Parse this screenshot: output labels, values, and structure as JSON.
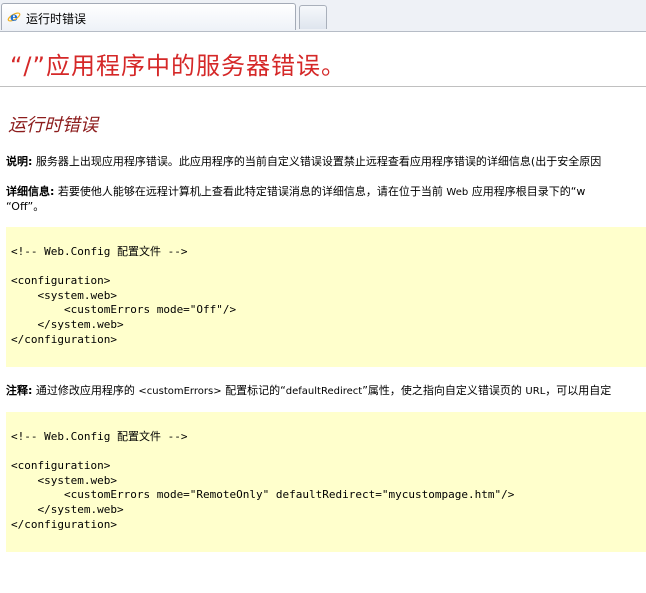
{
  "browser": {
    "tab_title": "运行时错误",
    "icons": {
      "tab_icon": "ie-logo-icon",
      "new_tab": "new-tab-button"
    }
  },
  "page": {
    "heading": "“/”应用程序中的服务器错误。",
    "subheading": "运行时错误",
    "description": {
      "label": "说明:",
      "text": " 服务器上出现应用程序错误。此应用程序的当前自定义错误设置禁止远程查看应用程序错误的详细信息(出于安全原因"
    },
    "details": {
      "label": "详细信息:",
      "text": " 若要使他人能够在远程计算机上查看此特定错误消息的详细信息，请在位于当前 ",
      "web": "Web",
      "text2": " 应用程序根目录下的“w",
      "line2": "“Off”。"
    },
    "code1": "<!-- Web.Config 配置文件 -->\n\n<configuration>\n    <system.web>\n        <customErrors mode=\"Off\"/>\n    </system.web>\n</configuration>",
    "note": {
      "label": "注释:",
      "text": " 通过修改应用程序的 ",
      "tag": "<customErrors>",
      "text2": " 配置标记的“",
      "attr": "defaultRedirect",
      "text3": "”属性，使之指向自定义错误页的 ",
      "url": "URL",
      "text4": "，可以用自定"
    },
    "code2": "<!-- Web.Config 配置文件 -->\n\n<configuration>\n    <system.web>\n        <customErrors mode=\"RemoteOnly\" defaultRedirect=\"mycustompage.htm\"/>\n    </system.web>\n</configuration>"
  },
  "colors": {
    "heading": "#d52828",
    "subheading": "#8c1c1c",
    "code_background": "#ffffcc"
  }
}
